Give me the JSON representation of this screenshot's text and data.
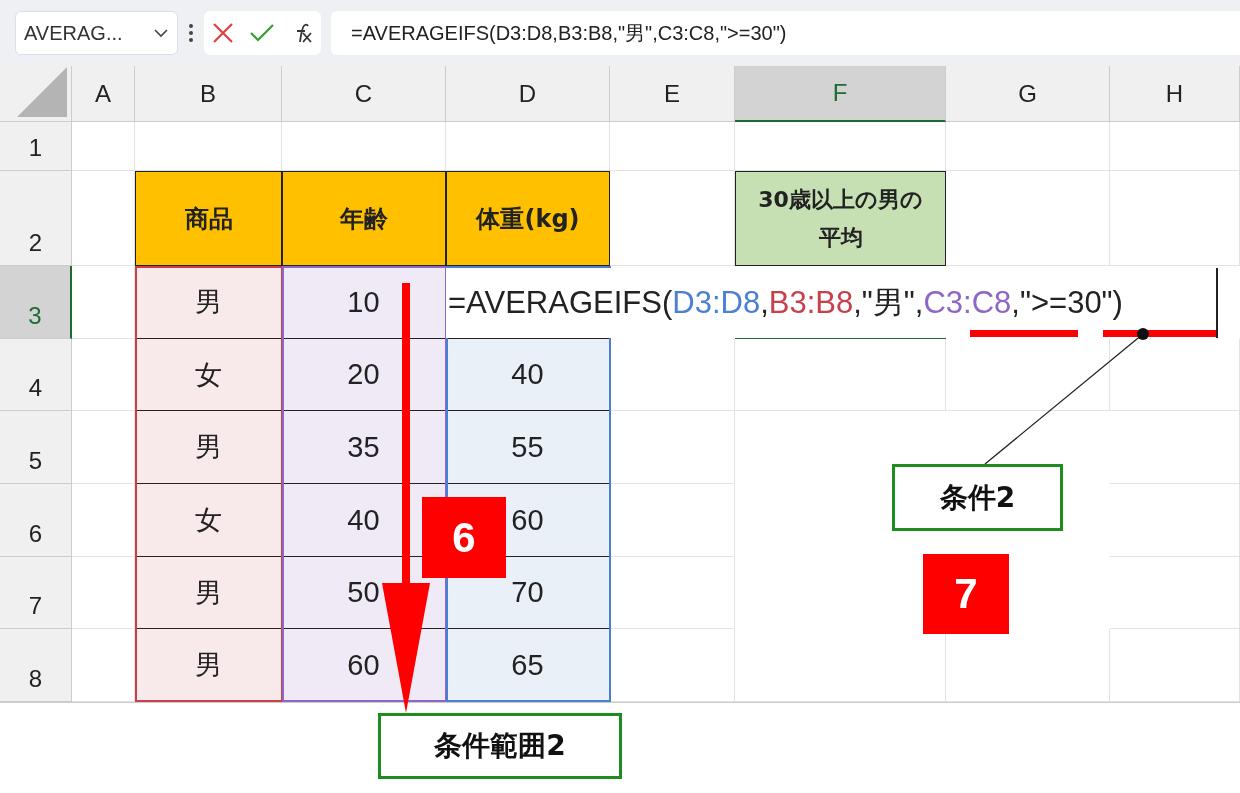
{
  "formula_bar": {
    "name_box": "AVERAG...",
    "formula": "=AVERAGEIFS(D3:D8,B3:B8,\"男\",C3:C8,\">=30\")"
  },
  "columns": [
    {
      "label": "A",
      "selected": false
    },
    {
      "label": "B",
      "selected": false
    },
    {
      "label": "C",
      "selected": false
    },
    {
      "label": "D",
      "selected": false
    },
    {
      "label": "E",
      "selected": false
    },
    {
      "label": "F",
      "selected": true
    },
    {
      "label": "G",
      "selected": false
    },
    {
      "label": "H",
      "selected": false
    }
  ],
  "rows": [
    {
      "label": "1",
      "selected": false
    },
    {
      "label": "2",
      "selected": false
    },
    {
      "label": "3",
      "selected": true
    },
    {
      "label": "4",
      "selected": false
    },
    {
      "label": "5",
      "selected": false
    },
    {
      "label": "6",
      "selected": false
    },
    {
      "label": "7",
      "selected": false
    },
    {
      "label": "8",
      "selected": false
    }
  ],
  "table": {
    "headers": [
      "商品",
      "年齢",
      "体重(kg)"
    ],
    "rows": [
      [
        "男",
        "10"
      ],
      [
        "女",
        "20",
        "40"
      ],
      [
        "男",
        "35",
        "55"
      ],
      [
        "女",
        "40",
        "60"
      ],
      [
        "男",
        "50",
        "70"
      ],
      [
        "男",
        "60",
        "65"
      ]
    ]
  },
  "result_cell": {
    "label": "30歳以上の男の平均"
  },
  "cell_editor": {
    "parts": [
      {
        "text": "=AVERAGEIFS(",
        "color": "#222222"
      },
      {
        "text": "D3:D8",
        "color": "#4a7fd4"
      },
      {
        "text": ",",
        "color": "#222222"
      },
      {
        "text": "B3:B8",
        "color": "#c8404a"
      },
      {
        "text": ",\"男\",",
        "color": "#222222"
      },
      {
        "text": "C3:C8",
        "color": "#9065c8"
      },
      {
        "text": ",\">=30\")",
        "color": "#222222"
      }
    ]
  },
  "annotations": {
    "steps": [
      {
        "number": "6"
      },
      {
        "number": "7"
      }
    ],
    "callouts": [
      {
        "text": "条件2"
      },
      {
        "text": "条件範囲2"
      }
    ]
  }
}
